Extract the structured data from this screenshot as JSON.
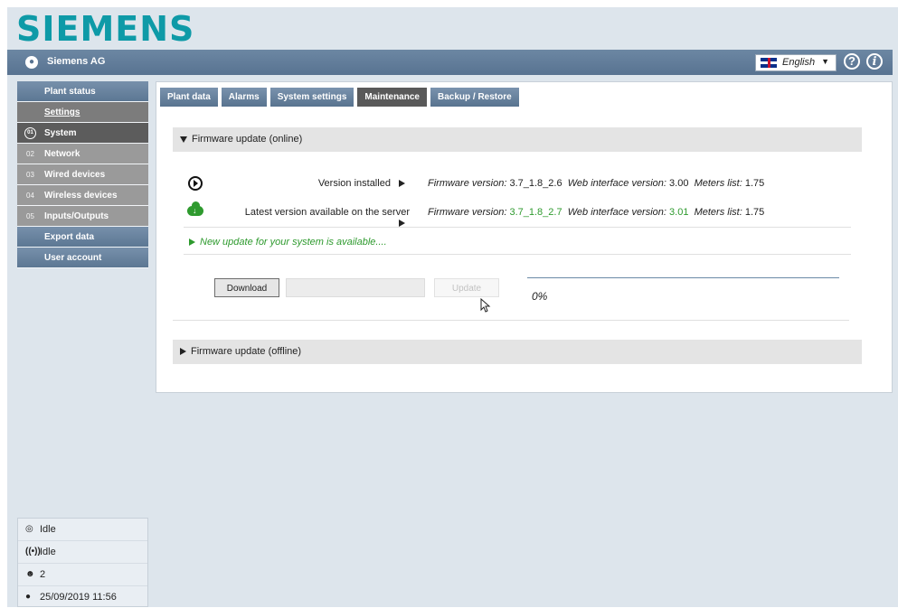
{
  "brand": {
    "logo_text": "SIEMENS"
  },
  "topbar": {
    "company": "Siemens AG",
    "language": "English"
  },
  "sidebar": {
    "items": [
      {
        "label": "Plant status"
      },
      {
        "label": "Settings"
      },
      {
        "label": "System",
        "num": "01"
      },
      {
        "label": "Network",
        "num": "02"
      },
      {
        "label": "Wired devices",
        "num": "03"
      },
      {
        "label": "Wireless devices",
        "num": "04"
      },
      {
        "label": "Inputs/Outputs",
        "num": "05"
      },
      {
        "label": "Export data"
      },
      {
        "label": "User account"
      }
    ]
  },
  "tabs": [
    {
      "label": "Plant data"
    },
    {
      "label": "Alarms"
    },
    {
      "label": "System settings"
    },
    {
      "label": "Maintenance",
      "active": true
    },
    {
      "label": "Backup / Restore"
    }
  ],
  "online": {
    "header": "Firmware update (online)",
    "installed": {
      "label": "Version installed",
      "fw_key": "Firmware version:",
      "fw_val": "3.7_1.8_2.6",
      "web_key": "Web interface version:",
      "web_val": "3.00",
      "meters_key": "Meters list:",
      "meters_val": "1.75"
    },
    "latest": {
      "label": "Latest version available on the server",
      "fw_key": "Firmware version:",
      "fw_val": "3.7_1.8_2.7",
      "web_key": "Web interface version:",
      "web_val": "3.01",
      "meters_key": "Meters list:",
      "meters_val": "1.75"
    },
    "notice": "New update for your system is available....",
    "download_label": "Download",
    "update_label": "Update",
    "progress_text": "0%",
    "progress": 0
  },
  "offline": {
    "header": "Firmware update (offline)"
  },
  "status": [
    {
      "icon": "modbus-icon",
      "text": "Idle"
    },
    {
      "icon": "wireless-icon",
      "text": "Idle"
    },
    {
      "icon": "users-icon",
      "text": "2"
    },
    {
      "icon": "clock-icon",
      "text": "25/09/2019 11:56"
    }
  ],
  "colors": {
    "brand": "#0e9aa7",
    "nav_blue": "#5c7793",
    "green": "#2e9a2e"
  }
}
